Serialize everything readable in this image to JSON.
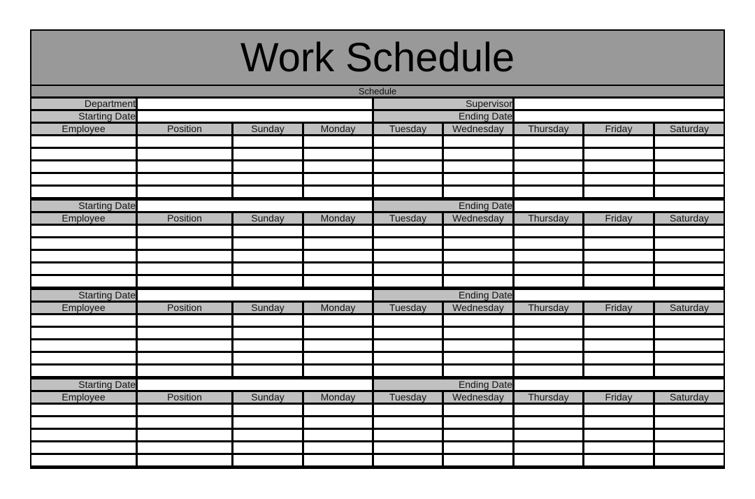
{
  "title": "Work Schedule",
  "subtitle": "Schedule",
  "labels": {
    "department": "Department",
    "supervisor": "Supervisor",
    "starting_date": "Starting Date",
    "ending_date": "Ending Date"
  },
  "columns": [
    "Employee",
    "Position",
    "Sunday",
    "Monday",
    "Tuesday",
    "Wednesday",
    "Thursday",
    "Friday",
    "Saturday"
  ],
  "fields": {
    "department": "",
    "supervisor": "",
    "blocks": [
      {
        "starting_date": "",
        "ending_date": ""
      },
      {
        "starting_date": "",
        "ending_date": ""
      },
      {
        "starting_date": "",
        "ending_date": ""
      },
      {
        "starting_date": "",
        "ending_date": ""
      }
    ]
  },
  "rows_per_block": 5,
  "colors": {
    "title_band": "#999999",
    "label_fill": "#c0c0c0",
    "grid": "#000000",
    "cell": "#ffffff"
  }
}
